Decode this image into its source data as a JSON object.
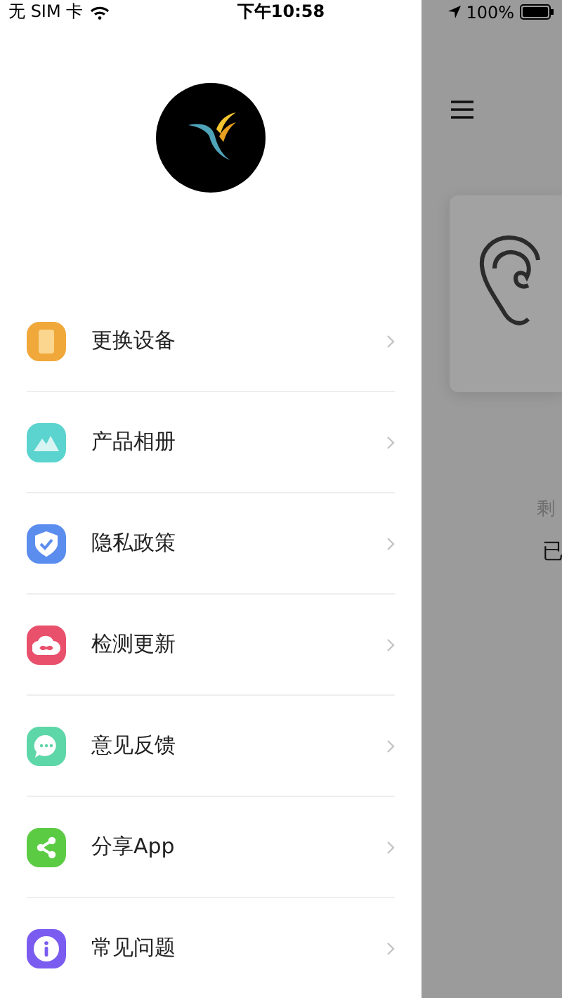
{
  "status_bar": {
    "carrier": "无 SIM 卡",
    "time": "下午10:58",
    "battery": "100%"
  },
  "drawer": {
    "menu": [
      {
        "label": "更换设备",
        "kind": "device",
        "color": "#f0a83a"
      },
      {
        "label": "产品相册",
        "kind": "album",
        "color": "#5bd3cf"
      },
      {
        "label": "隐私政策",
        "kind": "privacy",
        "color": "#5b8def"
      },
      {
        "label": "检测更新",
        "kind": "update",
        "color": "#e8506b"
      },
      {
        "label": "意见反馈",
        "kind": "feedback",
        "color": "#5dd6a8"
      },
      {
        "label": "分享App",
        "kind": "share",
        "color": "#5ccb44"
      },
      {
        "label": "常见问题",
        "kind": "faq",
        "color": "#7b5cf0"
      }
    ]
  },
  "main": {
    "remaining_label": "剩",
    "status": "已"
  }
}
